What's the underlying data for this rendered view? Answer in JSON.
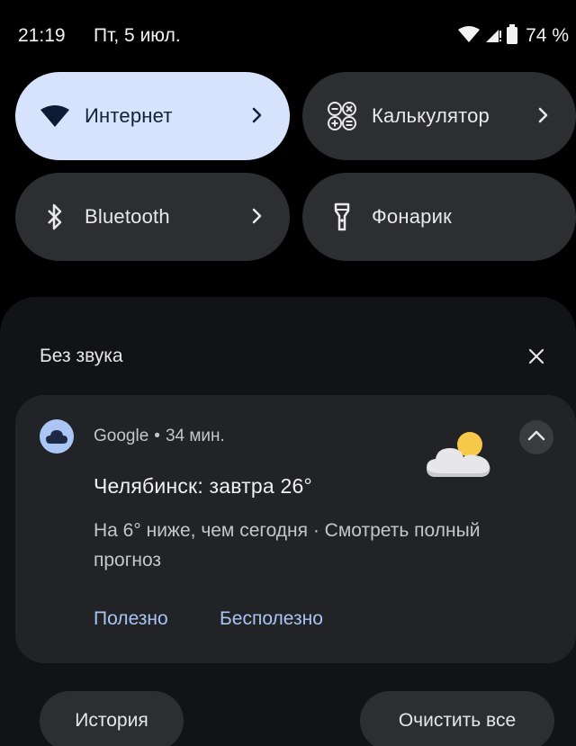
{
  "status_bar": {
    "time": "21:19",
    "date": "Пт, 5 июл.",
    "battery": "74 %"
  },
  "quick_tiles": {
    "internet": {
      "label": "Интернет",
      "icon": "wifi-icon",
      "active": true
    },
    "calculator": {
      "label": "Калькулятор",
      "icon": "calculator-icon",
      "active": false
    },
    "bluetooth": {
      "label": "Bluetooth",
      "icon": "bluetooth-icon",
      "active": false
    },
    "flashlight": {
      "label": "Фонарик",
      "icon": "flashlight-icon",
      "active": false
    }
  },
  "notifications": {
    "section_title": "Без звука",
    "card": {
      "app_name": "Google",
      "separator": "•",
      "time_ago": "34 мин.",
      "title": "Челябинск: завтра 26°",
      "body": "На 6° ниже, чем сегодня · Смотреть полный прогноз",
      "actions": {
        "useful": "Полезно",
        "useless": "Бесполезно"
      }
    }
  },
  "footer": {
    "history": "История",
    "clear_all": "Очистить все"
  },
  "colors": {
    "active_tile": "#d7e3fc",
    "tile": "#2d2e31",
    "link": "#a8c4f2",
    "app_icon_bg": "#a9c6f5"
  }
}
